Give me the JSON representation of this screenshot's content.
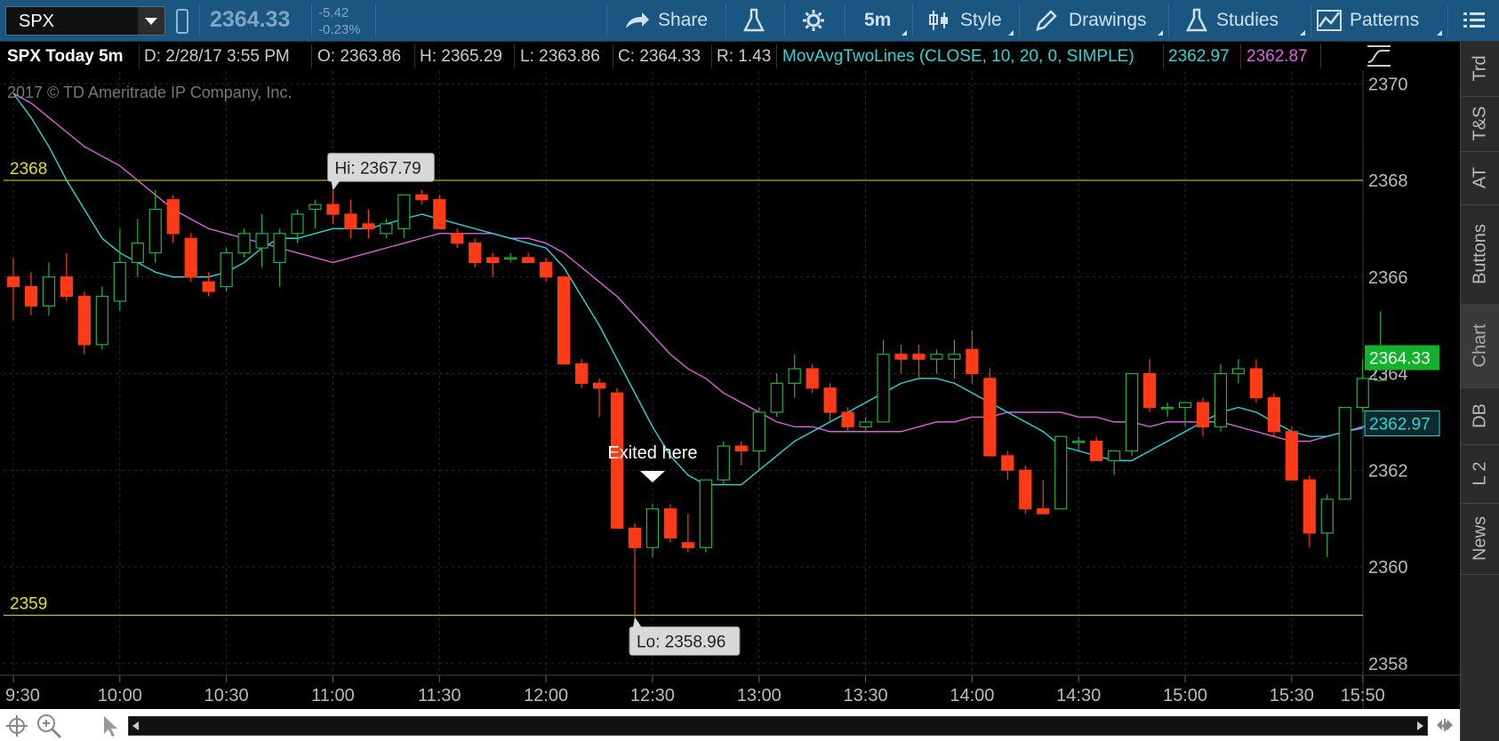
{
  "toolbar": {
    "symbol": "SPX",
    "last_price": "2364.33",
    "net_change": "-5.42",
    "pct_change": "-0.23%",
    "share_label": "Share",
    "timeframe_label": "5m",
    "style_label": "Style",
    "drawings_label": "Drawings",
    "studies_label": "Studies",
    "patterns_label": "Patterns"
  },
  "infobar": {
    "title": "SPX Today 5m",
    "date": "D: 2/28/17 3:55 PM",
    "open": "O: 2363.86",
    "high": "H: 2365.29",
    "low": "L: 2363.86",
    "close": "C: 2364.33",
    "range": "R: 1.43",
    "study": "MovAvgTwoLines (CLOSE, 10, 20, 0, SIMPLE)",
    "ma1_value": "2362.97",
    "ma2_value": "2362.87"
  },
  "sidebar": {
    "tabs": [
      "Trd",
      "T&S",
      "AT",
      "Buttons",
      "Chart",
      "DB",
      "L 2",
      "News"
    ],
    "active": "Chart"
  },
  "colors": {
    "up": "#21b33a",
    "down": "#ff3a16",
    "ma_fast": "#26d8d8",
    "ma_slow": "#e060e0",
    "level_line": "#e0e020",
    "last_price_tag": "#12b32a",
    "toolbar": "#1b5680"
  },
  "chart_data": {
    "type": "candlestick",
    "copyright": "2017 © TD Ameritrade IP Company, Inc.",
    "x_ticks": [
      "9:30",
      "10:00",
      "10:30",
      "11:00",
      "11:30",
      "12:00",
      "12:30",
      "13:00",
      "13:30",
      "14:00",
      "14:30",
      "15:00",
      "15:30",
      "15:50"
    ],
    "y_ticks": [
      2358,
      2360,
      2362,
      2364,
      2366,
      2368,
      2370
    ],
    "ylim": [
      2357.6,
      2370.3
    ],
    "candles": [
      {
        "t": "9:30",
        "o": 2366.0,
        "h": 2366.4,
        "l": 2365.1,
        "c": 2365.8
      },
      {
        "t": "9:35",
        "o": 2365.8,
        "h": 2366.1,
        "l": 2365.2,
        "c": 2365.4
      },
      {
        "t": "9:40",
        "o": 2365.4,
        "h": 2366.3,
        "l": 2365.2,
        "c": 2366.0
      },
      {
        "t": "9:45",
        "o": 2366.0,
        "h": 2366.5,
        "l": 2365.5,
        "c": 2365.6
      },
      {
        "t": "9:50",
        "o": 2365.6,
        "h": 2365.7,
        "l": 2364.4,
        "c": 2364.6
      },
      {
        "t": "9:55",
        "o": 2364.6,
        "h": 2365.8,
        "l": 2364.5,
        "c": 2365.6
      },
      {
        "t": "10:00",
        "o": 2365.5,
        "h": 2367.0,
        "l": 2365.3,
        "c": 2366.3
      },
      {
        "t": "10:05",
        "o": 2366.3,
        "h": 2367.2,
        "l": 2366.0,
        "c": 2366.7
      },
      {
        "t": "10:10",
        "o": 2366.5,
        "h": 2367.8,
        "l": 2366.3,
        "c": 2367.4
      },
      {
        "t": "10:15",
        "o": 2367.6,
        "h": 2367.7,
        "l": 2366.7,
        "c": 2366.9
      },
      {
        "t": "10:20",
        "o": 2366.8,
        "h": 2366.9,
        "l": 2365.9,
        "c": 2366.0
      },
      {
        "t": "10:25",
        "o": 2365.9,
        "h": 2366.1,
        "l": 2365.6,
        "c": 2365.7
      },
      {
        "t": "10:30",
        "o": 2365.8,
        "h": 2366.6,
        "l": 2365.7,
        "c": 2366.5
      },
      {
        "t": "10:35",
        "o": 2366.5,
        "h": 2367.0,
        "l": 2366.4,
        "c": 2366.9
      },
      {
        "t": "10:40",
        "o": 2366.6,
        "h": 2367.3,
        "l": 2366.2,
        "c": 2366.9
      },
      {
        "t": "10:45",
        "o": 2366.3,
        "h": 2367.0,
        "l": 2365.8,
        "c": 2366.9
      },
      {
        "t": "10:50",
        "o": 2366.9,
        "h": 2367.4,
        "l": 2366.7,
        "c": 2367.3
      },
      {
        "t": "10:55",
        "o": 2367.4,
        "h": 2367.6,
        "l": 2367.0,
        "c": 2367.5
      },
      {
        "t": "11:00",
        "o": 2367.5,
        "h": 2367.79,
        "l": 2367.1,
        "c": 2367.3
      },
      {
        "t": "11:05",
        "o": 2367.3,
        "h": 2367.6,
        "l": 2366.8,
        "c": 2367.0
      },
      {
        "t": "11:10",
        "o": 2367.1,
        "h": 2367.4,
        "l": 2366.8,
        "c": 2367.0
      },
      {
        "t": "11:15",
        "o": 2366.9,
        "h": 2367.2,
        "l": 2366.8,
        "c": 2367.1
      },
      {
        "t": "11:20",
        "o": 2367.0,
        "h": 2367.7,
        "l": 2366.8,
        "c": 2367.7
      },
      {
        "t": "11:25",
        "o": 2367.7,
        "h": 2367.8,
        "l": 2367.5,
        "c": 2367.6
      },
      {
        "t": "11:30",
        "o": 2367.6,
        "h": 2367.7,
        "l": 2367.0,
        "c": 2367.0
      },
      {
        "t": "11:35",
        "o": 2366.9,
        "h": 2367.0,
        "l": 2366.6,
        "c": 2366.7
      },
      {
        "t": "11:40",
        "o": 2366.7,
        "h": 2366.8,
        "l": 2366.2,
        "c": 2366.3
      },
      {
        "t": "11:45",
        "o": 2366.4,
        "h": 2366.5,
        "l": 2366.0,
        "c": 2366.3
      },
      {
        "t": "11:50",
        "o": 2366.4,
        "h": 2366.5,
        "l": 2366.3,
        "c": 2366.4
      },
      {
        "t": "11:55",
        "o": 2366.4,
        "h": 2366.5,
        "l": 2366.3,
        "c": 2366.3
      },
      {
        "t": "12:00",
        "o": 2366.3,
        "h": 2366.4,
        "l": 2365.9,
        "c": 2366.0
      },
      {
        "t": "12:05",
        "o": 2366.0,
        "h": 2366.0,
        "l": 2364.2,
        "c": 2364.2
      },
      {
        "t": "12:10",
        "o": 2364.2,
        "h": 2364.3,
        "l": 2363.7,
        "c": 2363.8
      },
      {
        "t": "12:15",
        "o": 2363.8,
        "h": 2363.9,
        "l": 2363.1,
        "c": 2363.7
      },
      {
        "t": "12:20",
        "o": 2363.6,
        "h": 2363.7,
        "l": 2360.8,
        "c": 2360.8
      },
      {
        "t": "12:25",
        "o": 2360.8,
        "h": 2360.9,
        "l": 2358.96,
        "c": 2360.4
      },
      {
        "t": "12:30",
        "o": 2360.4,
        "h": 2361.3,
        "l": 2360.2,
        "c": 2361.2
      },
      {
        "t": "12:35",
        "o": 2361.2,
        "h": 2361.3,
        "l": 2360.5,
        "c": 2360.6
      },
      {
        "t": "12:40",
        "o": 2360.5,
        "h": 2361.1,
        "l": 2360.3,
        "c": 2360.4
      },
      {
        "t": "12:45",
        "o": 2360.4,
        "h": 2361.8,
        "l": 2360.3,
        "c": 2361.8
      },
      {
        "t": "12:50",
        "o": 2361.8,
        "h": 2362.6,
        "l": 2361.7,
        "c": 2362.5
      },
      {
        "t": "12:55",
        "o": 2362.5,
        "h": 2362.6,
        "l": 2362.1,
        "c": 2362.4
      },
      {
        "t": "13:00",
        "o": 2362.4,
        "h": 2363.3,
        "l": 2362.0,
        "c": 2363.2
      },
      {
        "t": "13:05",
        "o": 2363.2,
        "h": 2364.0,
        "l": 2363.1,
        "c": 2363.8
      },
      {
        "t": "13:10",
        "o": 2363.8,
        "h": 2364.4,
        "l": 2363.5,
        "c": 2364.1
      },
      {
        "t": "13:15",
        "o": 2364.1,
        "h": 2364.2,
        "l": 2363.6,
        "c": 2363.7
      },
      {
        "t": "13:20",
        "o": 2363.7,
        "h": 2363.8,
        "l": 2363.0,
        "c": 2363.2
      },
      {
        "t": "13:25",
        "o": 2363.2,
        "h": 2363.3,
        "l": 2362.8,
        "c": 2362.9
      },
      {
        "t": "13:30",
        "o": 2362.9,
        "h": 2363.1,
        "l": 2362.8,
        "c": 2363.0
      },
      {
        "t": "13:35",
        "o": 2363.0,
        "h": 2364.7,
        "l": 2363.0,
        "c": 2364.4
      },
      {
        "t": "13:40",
        "o": 2364.4,
        "h": 2364.6,
        "l": 2364.0,
        "c": 2364.3
      },
      {
        "t": "13:45",
        "o": 2364.4,
        "h": 2364.6,
        "l": 2363.9,
        "c": 2364.3
      },
      {
        "t": "13:50",
        "o": 2364.3,
        "h": 2364.5,
        "l": 2364.0,
        "c": 2364.4
      },
      {
        "t": "13:55",
        "o": 2364.3,
        "h": 2364.7,
        "l": 2363.9,
        "c": 2364.4
      },
      {
        "t": "14:00",
        "o": 2364.5,
        "h": 2364.9,
        "l": 2363.8,
        "c": 2364.0
      },
      {
        "t": "14:05",
        "o": 2363.9,
        "h": 2364.1,
        "l": 2362.3,
        "c": 2362.3
      },
      {
        "t": "14:10",
        "o": 2362.3,
        "h": 2362.4,
        "l": 2361.8,
        "c": 2362.0
      },
      {
        "t": "14:15",
        "o": 2362.0,
        "h": 2362.1,
        "l": 2361.1,
        "c": 2361.2
      },
      {
        "t": "14:20",
        "o": 2361.2,
        "h": 2361.8,
        "l": 2361.1,
        "c": 2361.1
      },
      {
        "t": "14:25",
        "o": 2361.2,
        "h": 2362.7,
        "l": 2361.2,
        "c": 2362.7
      },
      {
        "t": "14:30",
        "o": 2362.6,
        "h": 2362.7,
        "l": 2362.4,
        "c": 2362.6
      },
      {
        "t": "14:35",
        "o": 2362.6,
        "h": 2362.7,
        "l": 2362.2,
        "c": 2362.2
      },
      {
        "t": "14:40",
        "o": 2362.2,
        "h": 2362.4,
        "l": 2361.9,
        "c": 2362.4
      },
      {
        "t": "14:45",
        "o": 2362.4,
        "h": 2364.0,
        "l": 2362.3,
        "c": 2364.0
      },
      {
        "t": "14:50",
        "o": 2364.0,
        "h": 2364.3,
        "l": 2363.2,
        "c": 2363.3
      },
      {
        "t": "14:55",
        "o": 2363.3,
        "h": 2363.4,
        "l": 2363.1,
        "c": 2363.3
      },
      {
        "t": "15:00",
        "o": 2363.3,
        "h": 2363.4,
        "l": 2362.9,
        "c": 2363.4
      },
      {
        "t": "15:05",
        "o": 2363.4,
        "h": 2363.5,
        "l": 2362.7,
        "c": 2362.9
      },
      {
        "t": "15:10",
        "o": 2362.9,
        "h": 2364.2,
        "l": 2362.8,
        "c": 2364.0
      },
      {
        "t": "15:15",
        "o": 2364.0,
        "h": 2364.3,
        "l": 2363.8,
        "c": 2364.1
      },
      {
        "t": "15:20",
        "o": 2364.1,
        "h": 2364.3,
        "l": 2363.4,
        "c": 2363.5
      },
      {
        "t": "15:25",
        "o": 2363.5,
        "h": 2363.6,
        "l": 2362.7,
        "c": 2362.8
      },
      {
        "t": "15:30",
        "o": 2362.8,
        "h": 2362.9,
        "l": 2361.8,
        "c": 2361.8
      },
      {
        "t": "15:35",
        "o": 2361.8,
        "h": 2361.9,
        "l": 2360.4,
        "c": 2360.7
      },
      {
        "t": "15:40",
        "o": 2360.7,
        "h": 2361.5,
        "l": 2360.2,
        "c": 2361.4
      },
      {
        "t": "15:45",
        "o": 2361.4,
        "h": 2363.3,
        "l": 2361.4,
        "c": 2363.3
      },
      {
        "t": "15:50",
        "o": 2363.3,
        "h": 2364.3,
        "l": 2363.2,
        "c": 2363.9
      },
      {
        "t": "15:55",
        "o": 2363.86,
        "h": 2365.29,
        "l": 2363.86,
        "c": 2364.33
      }
    ],
    "ma_fast": [
      2369.8,
      2369.3,
      2368.7,
      2368.0,
      2367.4,
      2366.8,
      2366.5,
      2366.3,
      2366.1,
      2366.0,
      2366.0,
      2366.0,
      2366.1,
      2366.3,
      2366.6,
      2366.8,
      2366.8,
      2366.9,
      2367.0,
      2367.0,
      2367.0,
      2367.1,
      2367.2,
      2367.3,
      2367.2,
      2367.1,
      2367.0,
      2366.9,
      2366.8,
      2366.7,
      2366.6,
      2366.2,
      2365.6,
      2365.0,
      2364.3,
      2363.6,
      2362.9,
      2362.3,
      2361.9,
      2361.7,
      2361.7,
      2361.7,
      2362.0,
      2362.3,
      2362.6,
      2362.8,
      2363.0,
      2363.2,
      2363.4,
      2363.6,
      2363.8,
      2363.9,
      2363.9,
      2363.8,
      2363.6,
      2363.4,
      2363.2,
      2363.0,
      2362.8,
      2362.5,
      2362.4,
      2362.3,
      2362.2,
      2362.2,
      2362.4,
      2362.6,
      2362.8,
      2363.0,
      2363.2,
      2363.3,
      2363.2,
      2363.0,
      2362.8,
      2362.7,
      2362.7,
      2362.8,
      2362.9,
      2362.97
    ],
    "ma_slow": [
      2369.8,
      2369.6,
      2369.3,
      2369.0,
      2368.7,
      2368.5,
      2368.3,
      2368.0,
      2367.7,
      2367.4,
      2367.2,
      2367.0,
      2366.9,
      2366.8,
      2366.7,
      2366.6,
      2366.5,
      2366.4,
      2366.3,
      2366.4,
      2366.5,
      2366.6,
      2366.7,
      2366.8,
      2366.9,
      2366.9,
      2366.9,
      2366.9,
      2366.8,
      2366.8,
      2366.7,
      2366.5,
      2366.2,
      2365.9,
      2365.6,
      2365.2,
      2364.8,
      2364.4,
      2364.1,
      2363.9,
      2363.6,
      2363.4,
      2363.2,
      2363.0,
      2362.9,
      2362.9,
      2362.8,
      2362.8,
      2362.8,
      2362.8,
      2362.8,
      2362.9,
      2363.0,
      2363.0,
      2363.1,
      2363.1,
      2363.2,
      2363.2,
      2363.2,
      2363.2,
      2363.1,
      2363.1,
      2363.0,
      2363.0,
      2362.9,
      2363.0,
      2363.0,
      2363.0,
      2363.0,
      2362.9,
      2362.8,
      2362.7,
      2362.6,
      2362.6,
      2362.7,
      2362.8,
      2362.87
    ],
    "levels": [
      {
        "label": "2368",
        "value": 2368.0
      },
      {
        "label": "2359",
        "value": 2359.0
      }
    ],
    "hi_label": "Hi: 2367.79",
    "lo_label": "Lo: 2358.96",
    "annotation": "Exited here",
    "last_tag": "2364.33",
    "ma_tag": "2362.97"
  }
}
